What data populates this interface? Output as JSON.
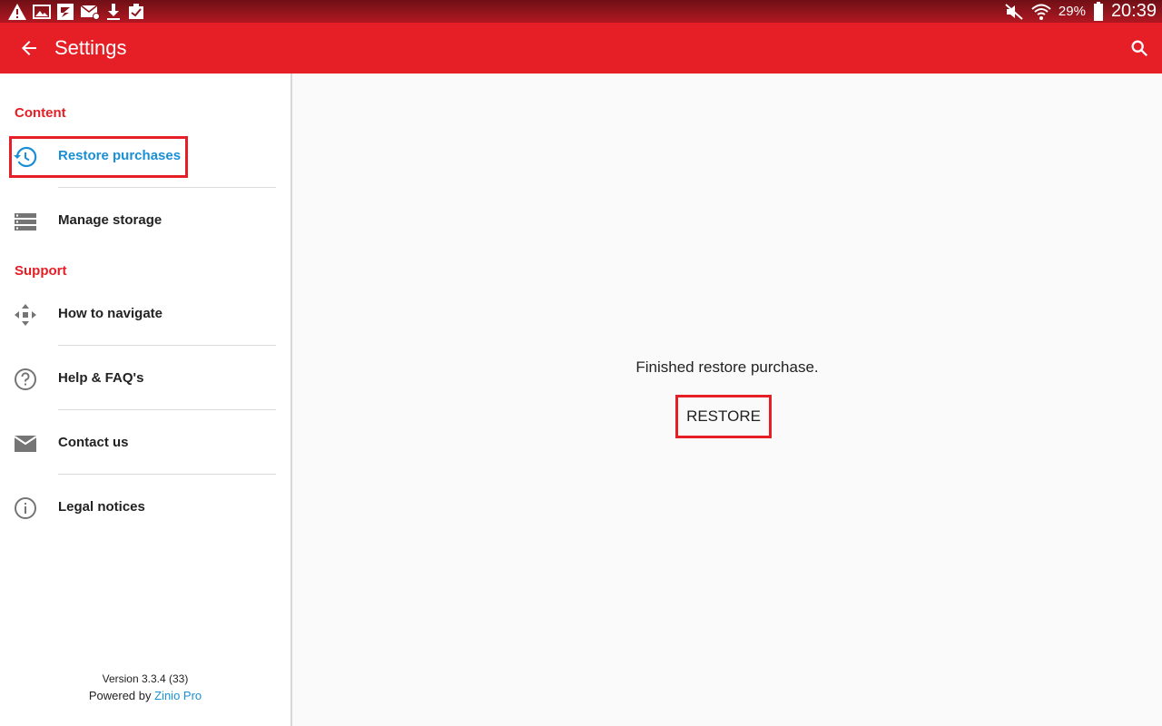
{
  "status_bar": {
    "battery_percent": "29%",
    "time": "20:39",
    "icons_left": [
      "warning-icon",
      "image-icon",
      "zinio-icon",
      "mail-icon",
      "download-icon",
      "clipboard-check-icon"
    ],
    "icons_right": [
      "mute-icon",
      "wifi-icon",
      "battery-icon"
    ]
  },
  "app_bar": {
    "title": "Settings",
    "background": "#e61e25"
  },
  "sidebar": {
    "sections": [
      {
        "title": "Content",
        "items": [
          {
            "label": "Restore purchases",
            "icon": "history-icon",
            "active": true
          },
          {
            "label": "Manage storage",
            "icon": "storage-icon"
          }
        ]
      },
      {
        "title": "Support",
        "items": [
          {
            "label": "How to navigate",
            "icon": "move-arrows-icon"
          },
          {
            "label": "Help & FAQ's",
            "icon": "help-circle-icon"
          },
          {
            "label": "Contact us",
            "icon": "mail-icon"
          },
          {
            "label": "Legal notices",
            "icon": "info-circle-icon"
          }
        ]
      }
    ],
    "version": "Version 3.3.4 (33)",
    "powered_by": "Powered by",
    "powered_link": "Zinio Pro"
  },
  "main": {
    "message": "Finished restore purchase.",
    "restore_button": "RESTORE"
  },
  "colors": {
    "accent": "#e61e25",
    "link": "#1a8fd6"
  }
}
